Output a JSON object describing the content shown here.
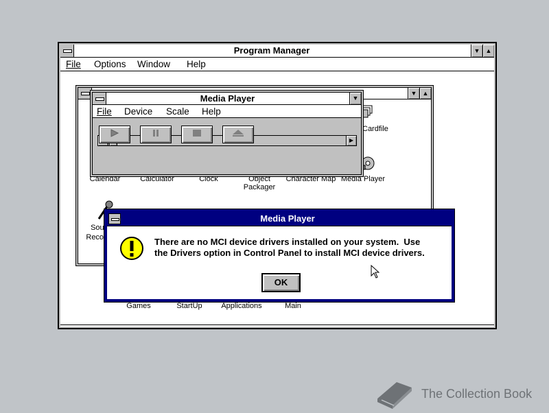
{
  "program_manager": {
    "title": "Program Manager",
    "menu": [
      "File",
      "Options",
      "Window",
      "Help"
    ]
  },
  "accessories_icons": [
    {
      "label": "Calendar"
    },
    {
      "label": "Calculator"
    },
    {
      "label": "Clock"
    },
    {
      "label": "Object\nPackager"
    },
    {
      "label": "Character Map"
    },
    {
      "label": "Media Player"
    },
    {
      "label": "Cardfile"
    },
    {
      "label": "Sound\nRecorder"
    }
  ],
  "group_icons": [
    {
      "label": "Games"
    },
    {
      "label": "StartUp"
    },
    {
      "label": "Applications"
    },
    {
      "label": "Main"
    }
  ],
  "media_player": {
    "title": "Media Player",
    "menu": [
      "File",
      "Device",
      "Scale",
      "Help"
    ],
    "buttons": [
      "play",
      "pause",
      "stop",
      "eject"
    ],
    "scroll_position": 0
  },
  "dialog": {
    "title": "Media Player",
    "message_line1": "There are no MCI device drivers installed on your system.  Use",
    "message_line2": "the Drivers option in Control Panel to install MCI device drivers.",
    "ok_label": "OK"
  },
  "watermark": {
    "text": "The Collection Book"
  },
  "colors": {
    "desktop": "#c0c4c8",
    "active_title": "#000080",
    "window": "#ffffff",
    "face": "#c0c0c0"
  }
}
